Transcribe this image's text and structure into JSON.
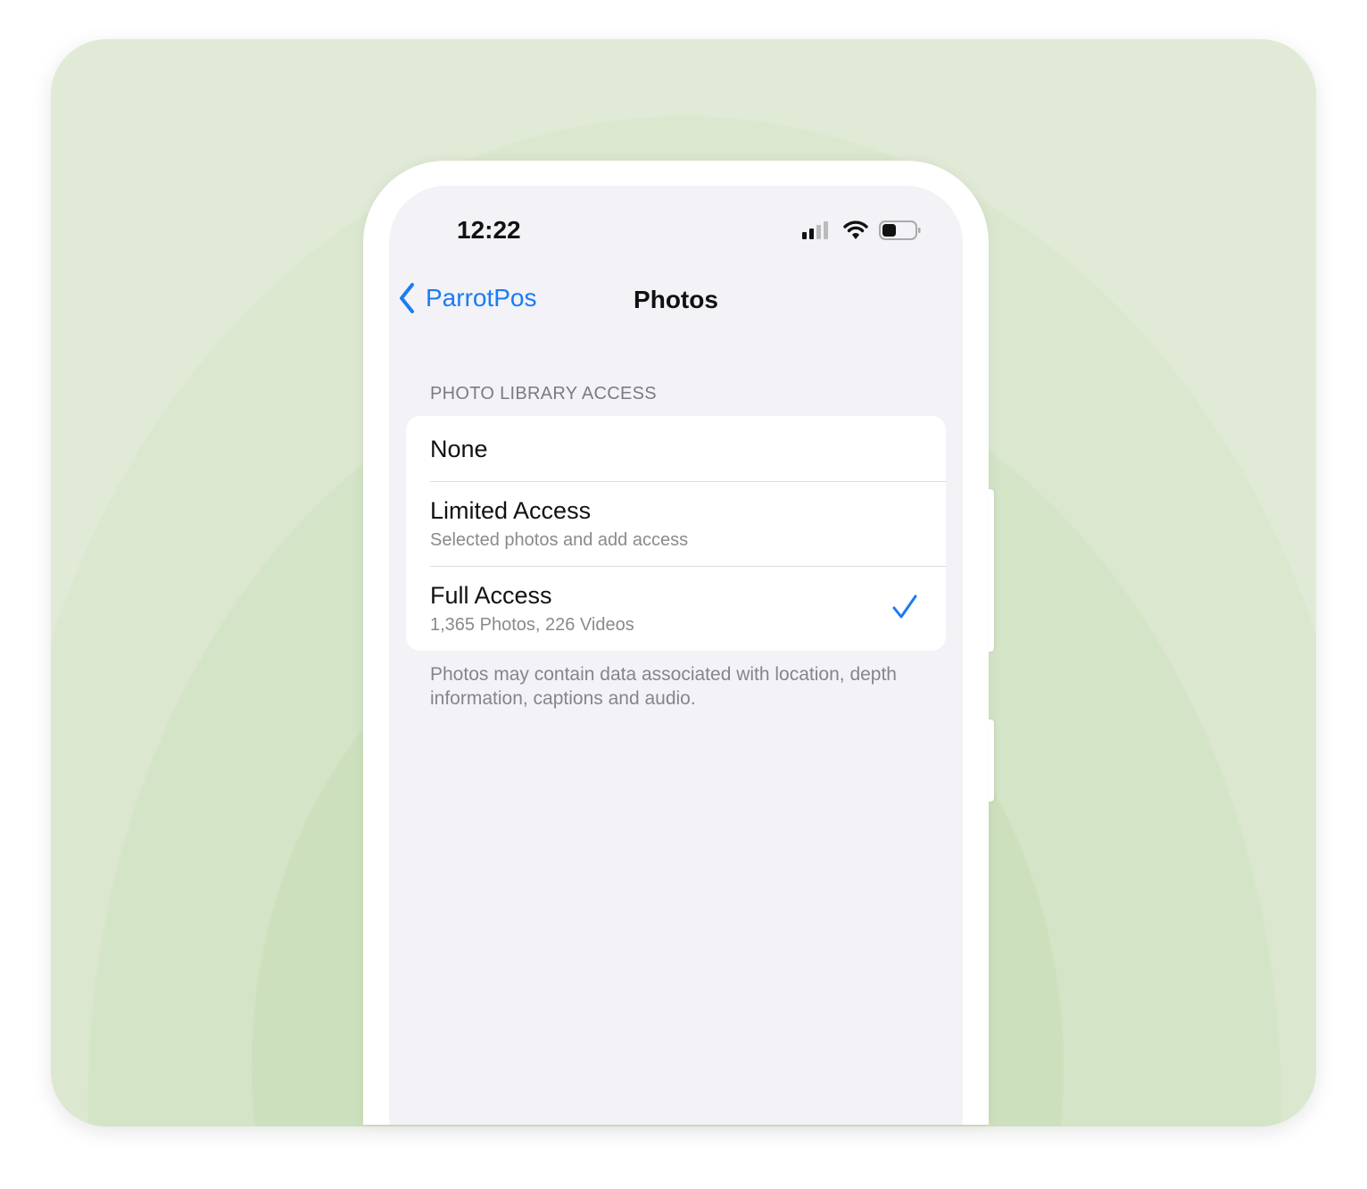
{
  "status_bar": {
    "time": "12:22",
    "icons": [
      "signal-icon",
      "wifi-icon",
      "battery-icon"
    ]
  },
  "nav": {
    "back_label": "ParrotPos",
    "title": "Photos"
  },
  "section": {
    "header": "PHOTO LIBRARY ACCESS",
    "options": [
      {
        "label": "None",
        "sublabel": null,
        "selected": false
      },
      {
        "label": "Limited Access",
        "sublabel": "Selected photos and add access",
        "selected": false
      },
      {
        "label": "Full Access",
        "sublabel": "1,365 Photos, 226 Videos",
        "selected": true
      }
    ],
    "footer": "Photos may contain data associated with location, depth information, captions and audio."
  },
  "colors": {
    "accent": "#1a7cf2",
    "background": "#f2f2f7",
    "card_green": "#dbe7cf"
  }
}
